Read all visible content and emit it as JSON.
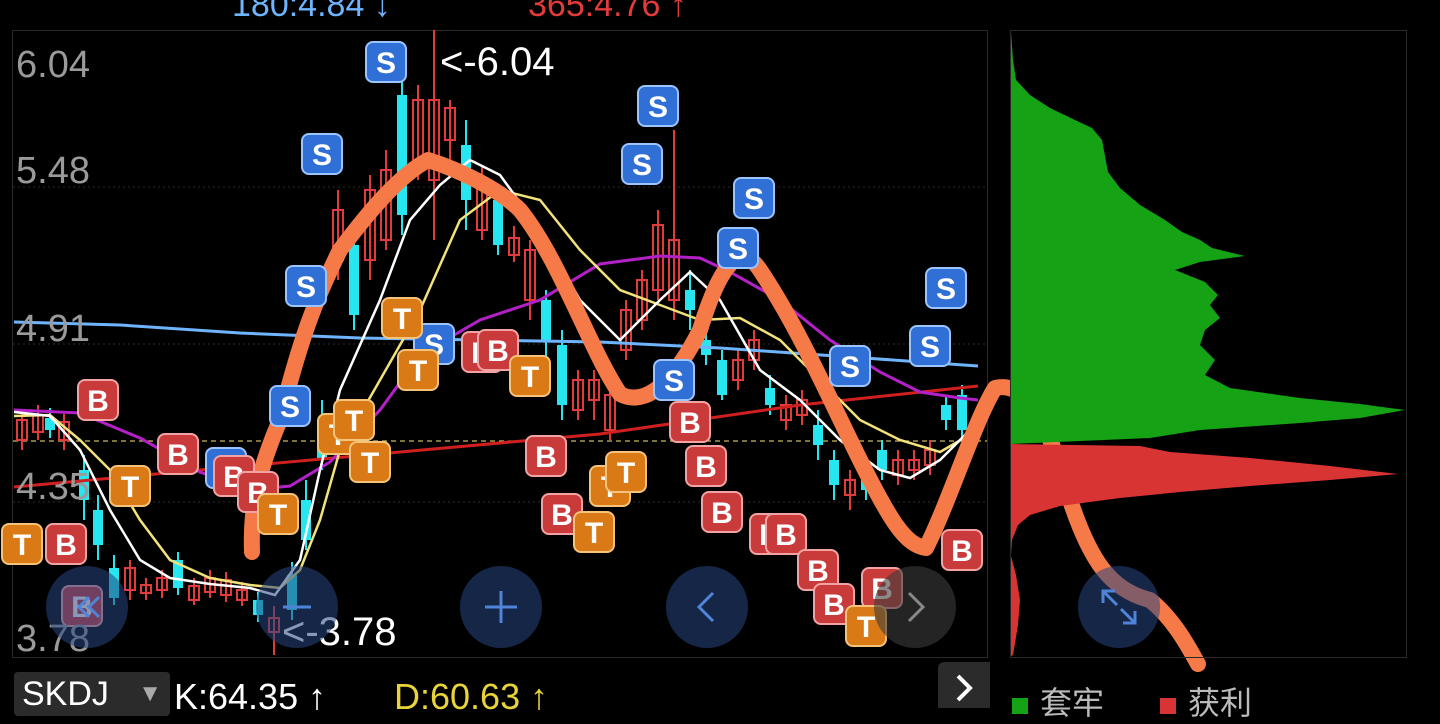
{
  "top": {
    "ma_left": "180:4.84 ↓",
    "ma_right": "365:4.76 ↑",
    "ma_left_color": "#6fb4ff",
    "ma_right_color": "#e23b3b"
  },
  "price_axis": {
    "labels": [
      "6.04",
      "5.48",
      "4.91",
      "4.35",
      "3.78"
    ]
  },
  "annotations": {
    "high": "<-6.04",
    "low": "<-3.78"
  },
  "markers": {
    "sell": "S",
    "buy": "B",
    "t": "T"
  },
  "controls": {
    "left_button": "left-arrows-icon",
    "minus_button": "minus-icon",
    "plus_button": "plus-icon",
    "prev_button": "chevron-left-icon",
    "next_button": "chevron-right-icon",
    "expand_button": "expand-icon",
    "panel_next": "chevron-right-icon"
  },
  "indicator": {
    "name": "SKDJ",
    "k_value": "K:64.35 ↑",
    "d_value": "D:60.63 ↑"
  },
  "volume_profile": {
    "legend_loss": "套牢",
    "legend_profit": "获利",
    "loss_color": "#15a315",
    "profit_color": "#d93434"
  },
  "colors": {
    "up": "#e23b3b",
    "down": "#27e6f0",
    "ma_white": "#ffffff",
    "ma_yellow": "#f1e27a",
    "ma_purple": "#b320c8",
    "ma_blue": "#6fb4ff",
    "trend_red": "#d01f1f",
    "overlay_orange": "#f57a47"
  }
}
